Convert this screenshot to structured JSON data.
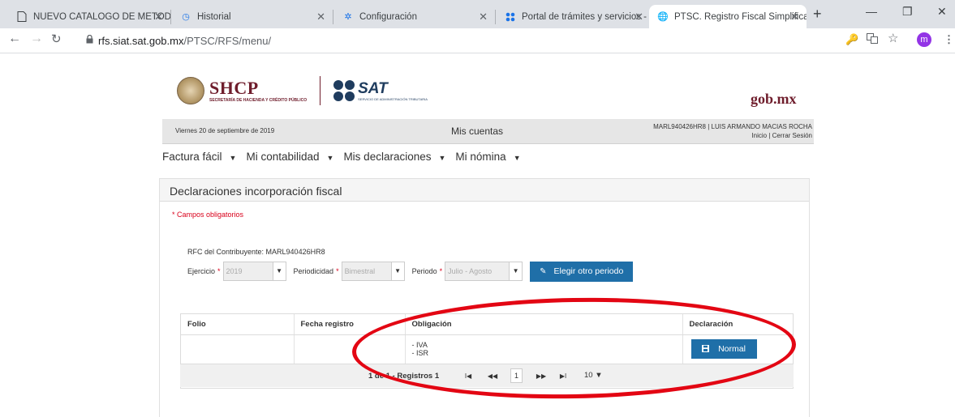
{
  "browser": {
    "tabs": [
      {
        "title": "NUEVO CATALOGO DE METOD",
        "icon": "document-icon"
      },
      {
        "title": "Historial",
        "icon": "history-icon"
      },
      {
        "title": "Configuración",
        "icon": "gear-icon"
      },
      {
        "title": "Portal de trámites y servicios -",
        "icon": "grid-icon"
      },
      {
        "title": "PTSC. Registro Fiscal Simplifica",
        "icon": "globe-icon"
      }
    ],
    "url_host": "rfs.siat.sat.gob.mx",
    "url_path": "/PTSC/RFS/menu/",
    "profile_initial": "m",
    "accent_color": "#1f6fa8"
  },
  "header": {
    "shcp_title": "SHCP",
    "shcp_subtitle": "SECRETARÍA DE HACIENDA Y CRÉDITO PÚBLICO",
    "sat_title": "SAT",
    "sat_subtitle": "SERVICIO DE ADMINISTRACIÓN TRIBUTARIA",
    "gobmx": "gob.mx"
  },
  "infobar": {
    "date": "Viernes 20 de septiembre de 2019",
    "center": "Mis cuentas",
    "user": "MARL940426HR8 | LUIS ARMANDO MACIAS ROCHA",
    "links": "Inicio | Cerrar Sesión"
  },
  "menu": [
    {
      "label": "Factura fácil"
    },
    {
      "label": "Mi contabilidad"
    },
    {
      "label": "Mis declaraciones"
    },
    {
      "label": "Mi nómina"
    }
  ],
  "panel": {
    "title": "Declaraciones incorporación fiscal",
    "required_note": "* Campos obligatorios",
    "rfc_line": "RFC del Contribuyente: MARL940426HR8",
    "filters": {
      "ejercicio_label": "Ejercicio",
      "ejercicio_value": "2019",
      "periodicidad_label": "Periodicidad",
      "periodicidad_value": "Bimestral",
      "periodo_label": "Periodo",
      "periodo_value": "Julio - Agosto",
      "star": "*",
      "button": "Elegir otro periodo"
    }
  },
  "table": {
    "headers": [
      "Folio",
      "Fecha registro",
      "Obligación",
      "Declaración"
    ],
    "rows": [
      {
        "folio": "",
        "fecha": "",
        "obligacion_1": "- IVA",
        "obligacion_2": "- ISR",
        "button": "Normal"
      }
    ],
    "pager": {
      "info": "1 de 1 - Registros 1",
      "first": "I◀",
      "prev": "◀◀",
      "page": "1",
      "next": "▶▶",
      "last": "▶I",
      "size": "10 ▼"
    }
  }
}
